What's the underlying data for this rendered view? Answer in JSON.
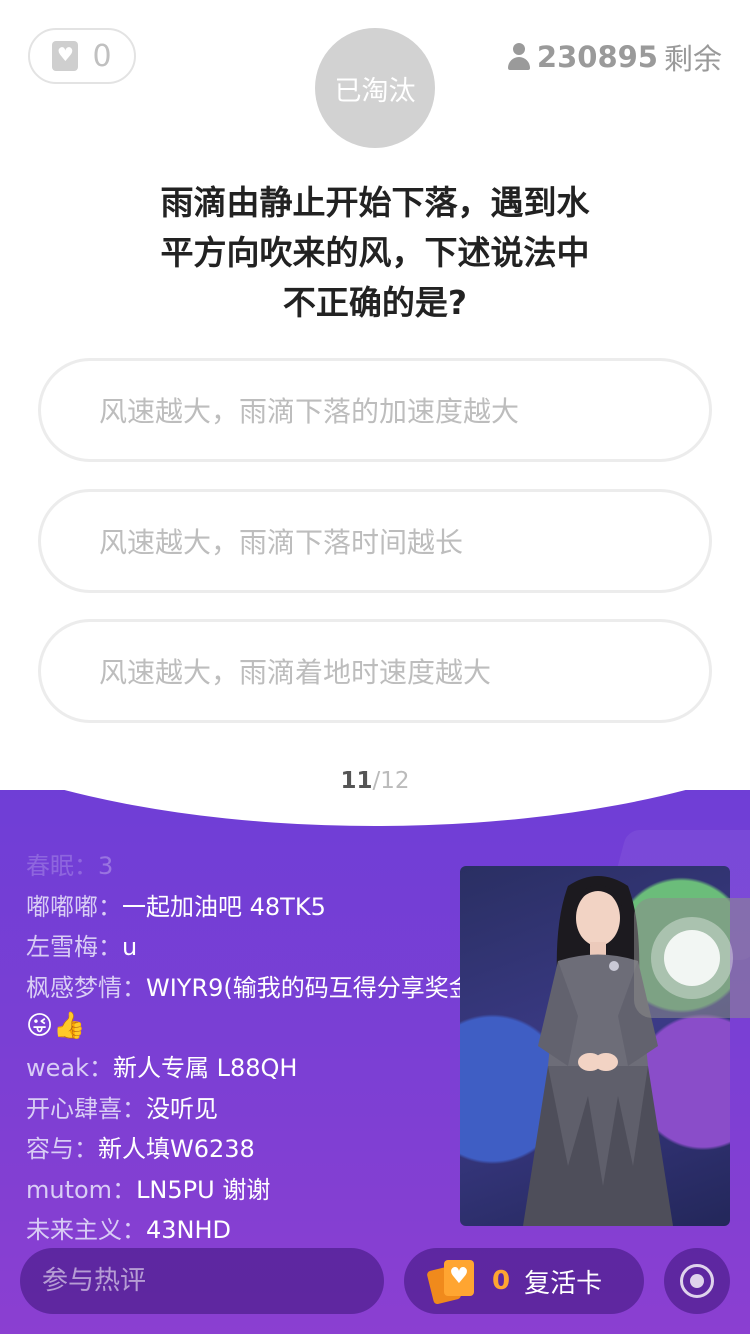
{
  "header": {
    "lives_count": "0",
    "status_label": "已淘汰",
    "remaining_count": "230895",
    "remaining_label": "剩余"
  },
  "question": {
    "line1": "雨滴由静止开始下落，遇到水",
    "line2": "平方向吹来的风，下述说法中",
    "line3": "不正确的是?"
  },
  "options": [
    {
      "label": "风速越大，雨滴下落的加速度越大"
    },
    {
      "label": "风速越大，雨滴下落时间越长"
    },
    {
      "label": "风速越大，雨滴着地时速度越大"
    }
  ],
  "progress": {
    "current": "11",
    "total": "/12"
  },
  "comments": [
    {
      "user": "春眠：",
      "text": "3"
    },
    {
      "user": "嘟嘟嘟：",
      "text": "一起加油吧 48TK5"
    },
    {
      "user": "左雪梅：",
      "text": "u"
    },
    {
      "user": "枫感梦情：",
      "text": "WIYR9(输我的码互得分享奖金)"
    },
    {
      "user": "",
      "text": "😜👍"
    },
    {
      "user": "weak：",
      "text": "新人专属  L88QH"
    },
    {
      "user": "开心肆喜：",
      "text": "没听见"
    },
    {
      "user": "容与：",
      "text": "新人填W6238"
    },
    {
      "user": "mutom：",
      "text": "LN5PU 谢谢"
    },
    {
      "user": "未来主义：",
      "text": "43NHD"
    }
  ],
  "bottom_bar": {
    "comment_placeholder": "参与热评",
    "revive_count": "0",
    "revive_label": "复活卡"
  },
  "colors": {
    "purple_top": "#6f3ed6",
    "purple_bottom": "#8b3fd1",
    "revive_orange": "#ffa531"
  }
}
